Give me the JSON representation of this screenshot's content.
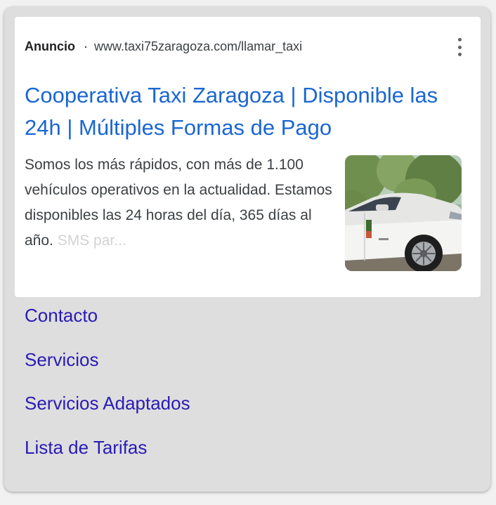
{
  "ad": {
    "label": "Anuncio",
    "separator": "·",
    "display_url": "www.taxi75zaragoza.com/llamar_taxi",
    "more_icon": "more-vert-icon",
    "headline": "Cooperativa Taxi Zaragoza | Disponible las 24h | Múltiples Formas de Pago",
    "description": "Somos los más rápidos, con más de 1.100 vehículos operativos en la actualidad. Estamos disponibles las 24 horas del día, 365 días al año.",
    "description_faded": "SMS par...",
    "thumbnail_icon": "taxi-image"
  },
  "sitelinks": [
    {
      "label": "Contacto"
    },
    {
      "label": "Servicios"
    },
    {
      "label": "Servicios Adaptados"
    },
    {
      "label": "Lista de Tarifas"
    }
  ],
  "colors": {
    "headline": "#1a66d2",
    "sitelink": "#2a1bb5",
    "panel_bg": "#dedede",
    "card_bg": "#ffffff"
  }
}
